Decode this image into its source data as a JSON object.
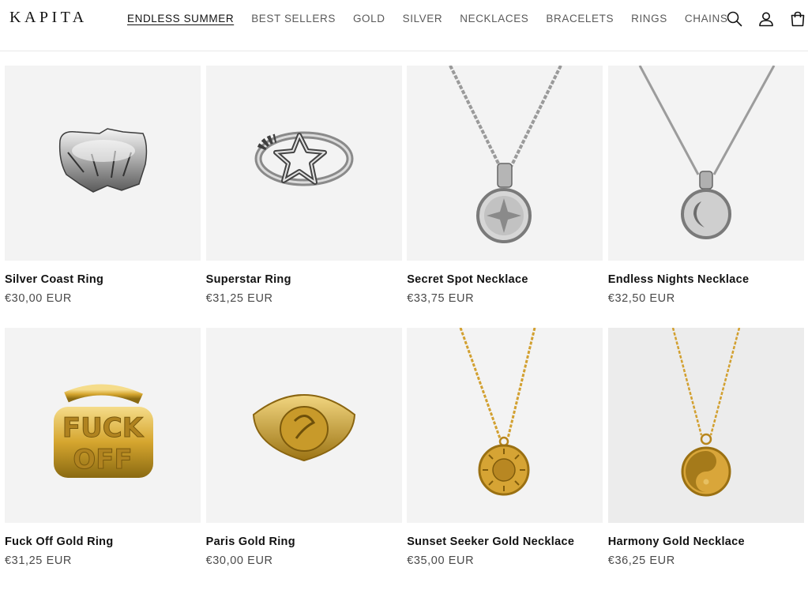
{
  "brand": {
    "name": "KAPITA"
  },
  "nav": {
    "items": [
      {
        "label": "ENDLESS SUMMER",
        "active": true
      },
      {
        "label": "BEST SELLERS"
      },
      {
        "label": "GOLD"
      },
      {
        "label": "SILVER"
      },
      {
        "label": "NECKLACES"
      },
      {
        "label": "BRACELETS"
      },
      {
        "label": "RINGS"
      },
      {
        "label": "CHAINS"
      }
    ]
  },
  "header_icons": [
    "search-icon",
    "account-icon",
    "cart-icon"
  ],
  "colors": {
    "silver": "#c8c8c8",
    "gold": "#d4a32c",
    "card_bg": "#f3f3f3"
  },
  "products": [
    {
      "title": "Silver Coast Ring",
      "price": "€30,00 EUR",
      "metal": "silver",
      "kind": "ring-wide"
    },
    {
      "title": "Superstar Ring",
      "price": "€31,25 EUR",
      "metal": "silver",
      "kind": "ring-star"
    },
    {
      "title": "Secret Spot Necklace",
      "price": "€33,75 EUR",
      "metal": "silver",
      "kind": "necklace-compass"
    },
    {
      "title": "Endless Nights Necklace",
      "price": "€32,50 EUR",
      "metal": "silver",
      "kind": "necklace-moon"
    },
    {
      "title": "Fuck Off Gold Ring",
      "price": "€31,25 EUR",
      "metal": "gold",
      "kind": "ring-letters"
    },
    {
      "title": "Paris Gold Ring",
      "price": "€30,00 EUR",
      "metal": "gold",
      "kind": "ring-signet"
    },
    {
      "title": "Sunset Seeker Gold Necklace",
      "price": "€35,00 EUR",
      "metal": "gold",
      "kind": "necklace-sun"
    },
    {
      "title": "Harmony Gold Necklace",
      "price": "€36,25 EUR",
      "metal": "gold",
      "kind": "necklace-yinyang"
    }
  ]
}
